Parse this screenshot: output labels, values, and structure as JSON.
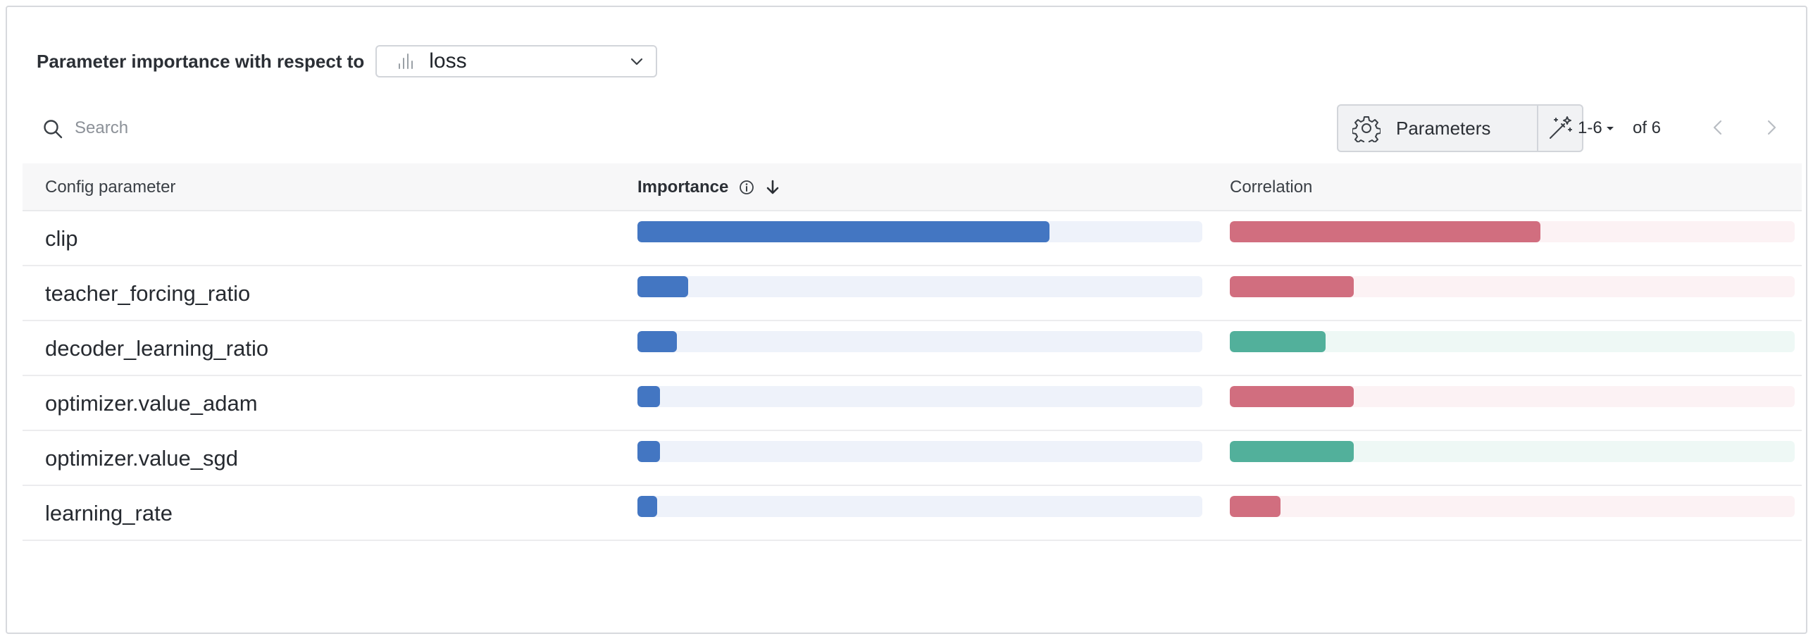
{
  "header": {
    "title": "Parameter importance with respect to",
    "metric": {
      "value": "loss",
      "icon": "bar-chart-icon"
    }
  },
  "search": {
    "placeholder": "Search",
    "value": ""
  },
  "toolbar": {
    "parameters_label": "Parameters",
    "magic_icon": "magic-wand-icon",
    "page_range": "1-6",
    "page_total": "of 6"
  },
  "table": {
    "columns": [
      "Config parameter",
      "Importance",
      "Correlation"
    ],
    "rows": [
      {
        "param": "clip",
        "importance": 0.73,
        "correlation": 0.55
      },
      {
        "param": "teacher_forcing_ratio",
        "importance": 0.09,
        "correlation": 0.22
      },
      {
        "param": "decoder_learning_ratio",
        "importance": 0.07,
        "correlation": -0.17
      },
      {
        "param": "optimizer.value_adam",
        "importance": 0.04,
        "correlation": 0.22
      },
      {
        "param": "optimizer.value_sgd",
        "importance": 0.04,
        "correlation": -0.22
      },
      {
        "param": "learning_rate",
        "importance": 0.035,
        "correlation": 0.09
      }
    ]
  },
  "colors": {
    "importance": "#4376c2",
    "positive_correlation": "#d16e7f",
    "negative_correlation": "#52b09b"
  }
}
